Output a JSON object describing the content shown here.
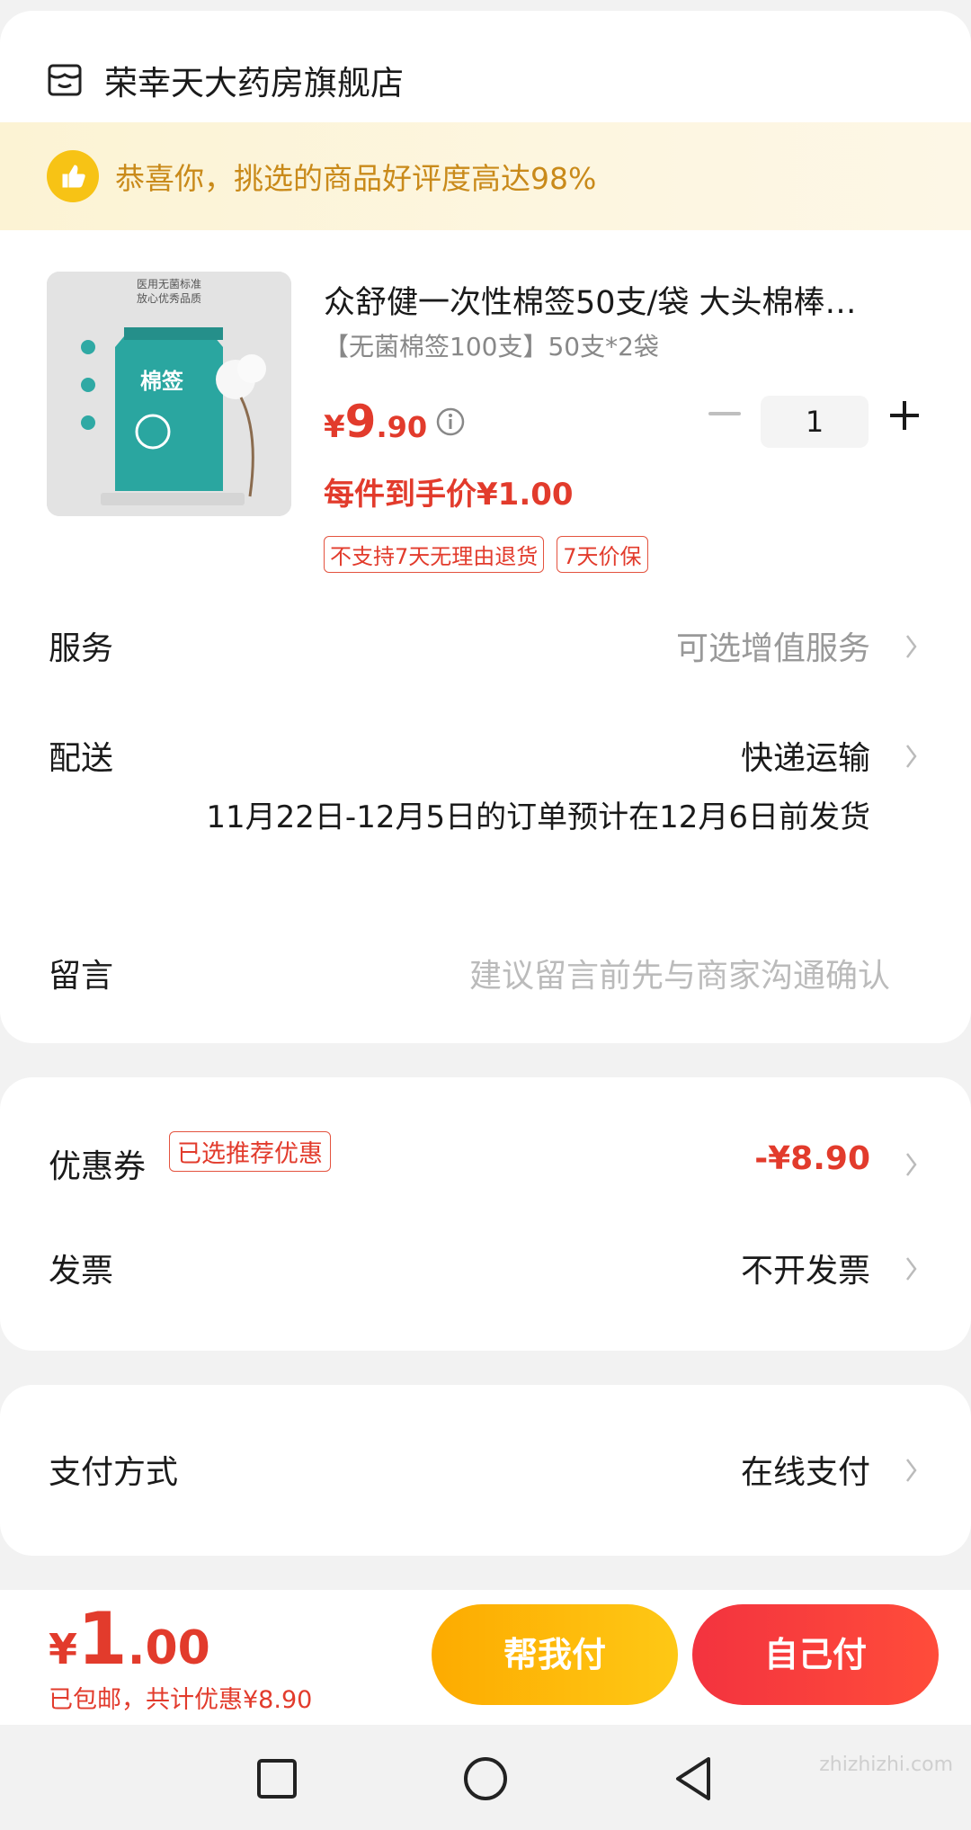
{
  "store": {
    "name": "荣幸天大药房旗舰店",
    "icon": "store-icon"
  },
  "banner": {
    "text": "恭喜你，挑选的商品好评度高达98%",
    "icon": "thumbs-up-icon"
  },
  "product": {
    "title": "众舒健一次性棉签50支/袋 大头棉棒…",
    "spec": "【无菌棉签100支】50支*2袋",
    "price_currency": "¥",
    "price_integer": "9",
    "price_decimal": ".90",
    "quantity": "1",
    "final_price": "每件到手价¥1.00",
    "tags": [
      "不支持7天无理由退货",
      "7天价保"
    ],
    "image_text": {
      "line1": "医用无菌标准",
      "line2": "放心优秀品质",
      "pack_label": "棉签"
    }
  },
  "rows": {
    "service": {
      "label": "服务",
      "value": "可选增值服务"
    },
    "delivery": {
      "label": "配送",
      "value": "快递运输",
      "note": "11月22日-12月5日的订单预计在12月6日前发货"
    },
    "message": {
      "label": "留言",
      "placeholder": "建议留言前先与商家沟通确认"
    },
    "coupon": {
      "label": "优惠券",
      "badge": "已选推荐优惠",
      "value": "-¥8.90"
    },
    "invoice": {
      "label": "发票",
      "value": "不开发票"
    },
    "payment": {
      "label": "支付方式",
      "value": "在线支付"
    }
  },
  "footer": {
    "total_currency": "¥",
    "total_integer": "1",
    "total_decimal": ".00",
    "sub": "已包邮，共计优惠¥8.90",
    "help_pay": "帮我付",
    "self_pay": "自己付"
  },
  "watermark": "zhizhizhi.com",
  "colors": {
    "accent": "#e23b2c",
    "banner_text": "#c98a1a",
    "help_btn": "#fdab00",
    "self_btn": "#f3333f"
  }
}
